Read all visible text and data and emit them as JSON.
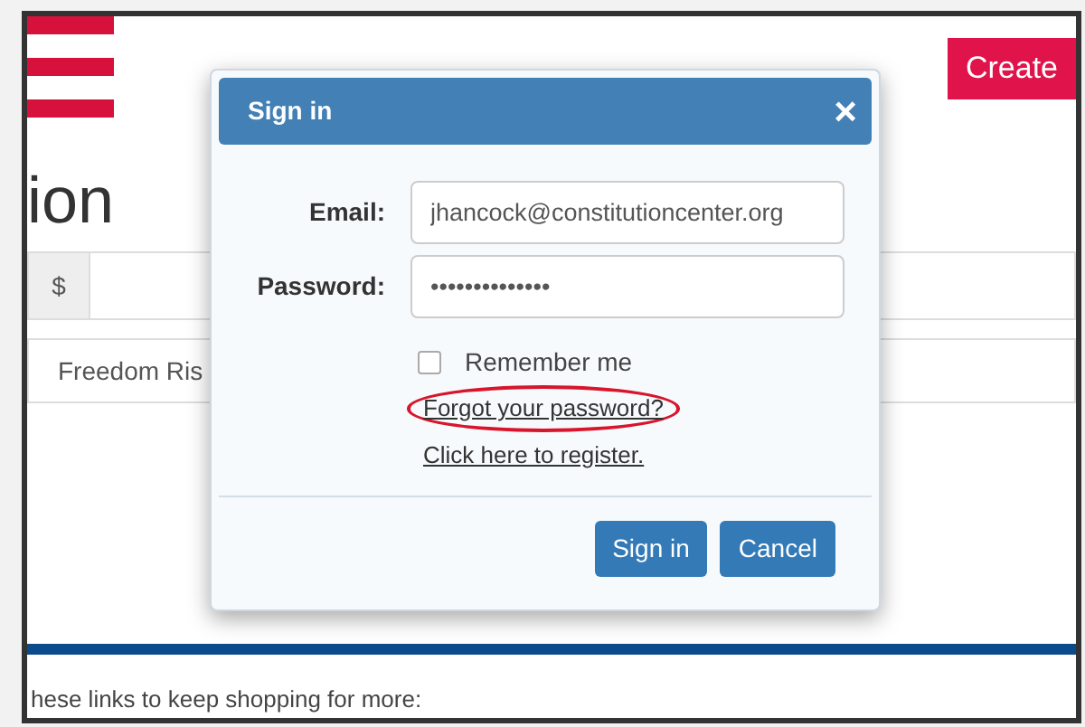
{
  "page": {
    "create_button": "Create",
    "heading": "ion",
    "currency_addon": "$",
    "item_title": "Freedom Ris",
    "footer_text": "hese links to keep shopping for more:"
  },
  "modal": {
    "title": "Sign in",
    "close": "×",
    "fields": [
      {
        "label": "Email:",
        "value": "jhancock@constitutioncenter.org"
      },
      {
        "label": "Password:",
        "value": "••••••••••••••"
      }
    ],
    "remember": {
      "label": "Remember me",
      "checked": false
    },
    "links": [
      {
        "text": "Forgot your password?",
        "highlighted": true
      },
      {
        "text": "Click here to register.",
        "highlighted": false
      }
    ],
    "buttons": [
      "Sign in",
      "Cancel"
    ]
  }
}
